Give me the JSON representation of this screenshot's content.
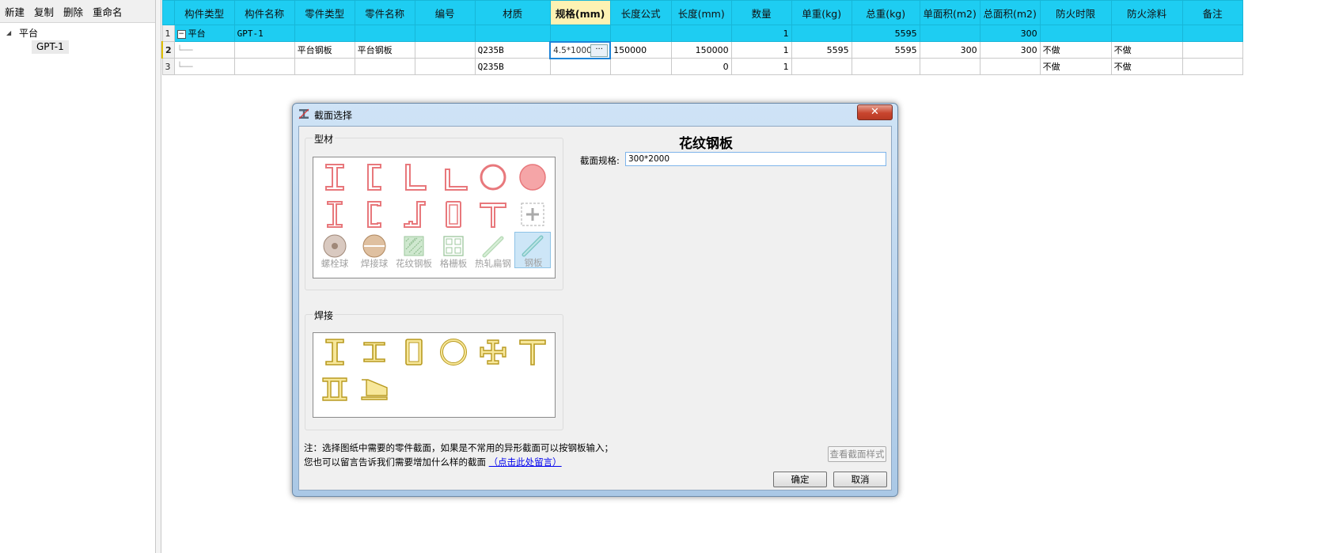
{
  "left_toolbar": {
    "new": "新建",
    "copy": "复制",
    "delete": "删除",
    "rename": "重命名"
  },
  "tree": {
    "root": "平台",
    "child": "GPT-1"
  },
  "grid": {
    "columns": [
      "构件类型",
      "构件名称",
      "零件类型",
      "零件名称",
      "编号",
      "材质",
      "规格(mm)",
      "长度公式",
      "长度(mm)",
      "数量",
      "单重(kg)",
      "总重(kg)",
      "单面积(m2)",
      "总面积(m2)",
      "防火时限",
      "防火涂料",
      "备注"
    ],
    "rows": [
      {
        "no": "1",
        "c0": "平台",
        "c1": "GPT-1",
        "c2": "",
        "c3": "",
        "c4": "",
        "c5": "",
        "c6": "",
        "c7": "",
        "c8": "",
        "c9": "1",
        "c10": "",
        "c11": "5595",
        "c12": "",
        "c13": "300",
        "c14": "",
        "c15": "",
        "c16": ""
      },
      {
        "no": "2",
        "c0": "",
        "c1": "",
        "c2": "平台钢板",
        "c3": "平台钢板",
        "c4": "",
        "c5": "Q235B",
        "c6": "4.5*1000",
        "c7": "150000",
        "c8": "150000",
        "c9": "1",
        "c10": "5595",
        "c11": "5595",
        "c12": "300",
        "c13": "300",
        "c14": "不做",
        "c15": "不做",
        "c16": ""
      },
      {
        "no": "3",
        "c0": "",
        "c1": "",
        "c2": "",
        "c3": "",
        "c4": "",
        "c5": "Q235B",
        "c6": "",
        "c7": "",
        "c8": "0",
        "c9": "1",
        "c10": "",
        "c11": "",
        "c12": "",
        "c13": "",
        "c14": "不做",
        "c15": "不做",
        "c16": ""
      }
    ],
    "edit_button": "···"
  },
  "dialog": {
    "title": "截面选择",
    "close": "✕",
    "group_profile": "型材",
    "group_weld": "焊接",
    "profile_labels": [
      "螺栓球",
      "焊接球",
      "花纹钢板",
      "格栅板",
      "热轧扁钢",
      "钢板"
    ],
    "section_heading": "花纹钢板",
    "spec_label": "截面规格:",
    "spec_value": "300*2000",
    "note_line1": "注：选择图纸中需要的零件截面，如果是不常用的异形截面可以按钢板输入；",
    "note_line2_prefix": "您也可以留言告诉我们需要增加什么样的截面",
    "note_link": "（点击此处留言）",
    "btn_view": "查看截面样式",
    "btn_ok": "确定",
    "btn_cancel": "取消"
  },
  "colors": {
    "header": "#1ecdf2",
    "active_header": "#fdf2b3",
    "profile_icon": "#e8787c",
    "weld_icon": "#c9a227"
  }
}
